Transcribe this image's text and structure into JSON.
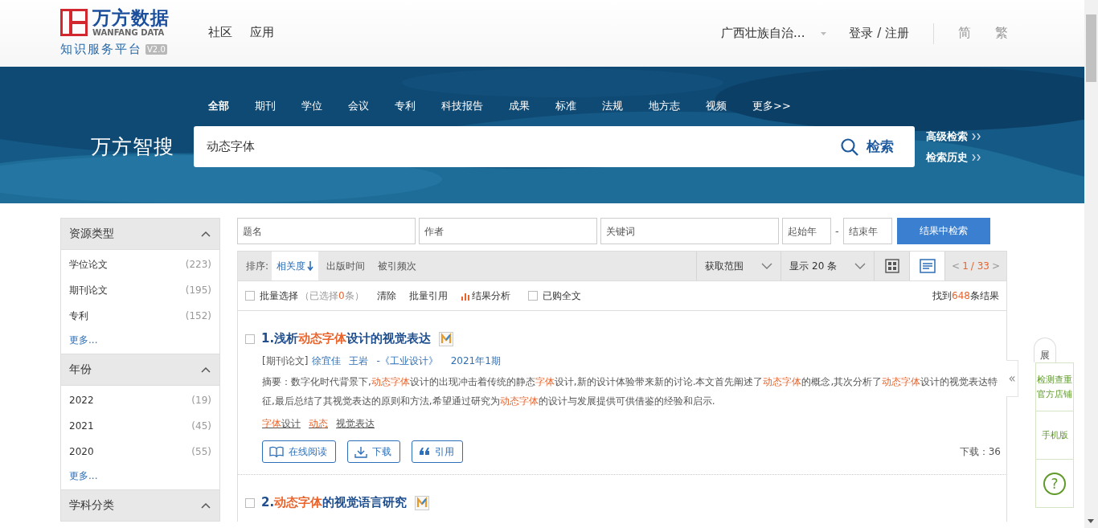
{
  "header": {
    "logo_name": "万方数据",
    "logo_sub": "WANFANG DATA",
    "platform": "知识服务平台",
    "version": "V2.0",
    "nav": [
      "社区",
      "应用"
    ],
    "region": "广西壮族自治...",
    "login": "登录 / 注册",
    "lang": [
      {
        "label": "简",
        "selected": false
      },
      {
        "label": "繁",
        "selected": false
      }
    ]
  },
  "search": {
    "tabs": [
      {
        "label": "全部",
        "selected": true
      },
      {
        "label": "期刊",
        "selected": false
      },
      {
        "label": "学位",
        "selected": false
      },
      {
        "label": "会议",
        "selected": false
      },
      {
        "label": "专利",
        "selected": false
      },
      {
        "label": "科技报告",
        "selected": false
      },
      {
        "label": "成果",
        "selected": false
      },
      {
        "label": "标准",
        "selected": false
      },
      {
        "label": "法规",
        "selected": false
      },
      {
        "label": "地方志",
        "selected": false
      },
      {
        "label": "视频",
        "selected": false
      },
      {
        "label": "更多>>",
        "selected": false
      }
    ],
    "brand": "万方智搜",
    "value": "动态字体",
    "button": "检索",
    "links": [
      "高级检索",
      "检索历史"
    ]
  },
  "facets": [
    {
      "title": "资源类型",
      "expanded": true,
      "items": [
        {
          "label": "学位论文",
          "count": "(223)"
        },
        {
          "label": "期刊论文",
          "count": "(195)"
        },
        {
          "label": "专利",
          "count": "(152)"
        }
      ],
      "more": "更多..."
    },
    {
      "title": "年份",
      "expanded": true,
      "items": [
        {
          "label": "2022",
          "count": "(19)"
        },
        {
          "label": "2021",
          "count": "(45)"
        },
        {
          "label": "2020",
          "count": "(55)"
        }
      ],
      "more": "更多..."
    },
    {
      "title": "学科分类",
      "expanded": true
    }
  ],
  "filters": {
    "fields": [
      {
        "placeholder": "题名"
      },
      {
        "placeholder": "作者"
      },
      {
        "placeholder": "关键词"
      },
      {
        "placeholder": "起始年"
      },
      {
        "placeholder": "结束年"
      }
    ],
    "dash": "-",
    "button": "结果中检索"
  },
  "sortbar": {
    "label": "排序:",
    "options": [
      {
        "label": "相关度",
        "selected": true
      },
      {
        "label": "出版时间",
        "selected": false
      },
      {
        "label": "被引频次",
        "selected": false
      }
    ],
    "range": "获取范围",
    "page_size": "显示 20 条",
    "views": [
      {
        "kind": "grid",
        "selected": false
      },
      {
        "kind": "list",
        "selected": true
      }
    ],
    "pager": {
      "prev": "<",
      "current": "1",
      "total": "/ 33",
      "next": ">"
    }
  },
  "actions": {
    "batch_select": {
      "label": "批量选择",
      "checked": false
    },
    "selected_pre": "（已选择",
    "selected_count": "0",
    "selected_post": "条）",
    "clear": "清除",
    "cite": "批量引用",
    "analysis": "结果分析",
    "purchased": {
      "label": "已购全文",
      "checked": false
    },
    "found_pre": "找到",
    "found_count": "648",
    "found_post": "条结果"
  },
  "results": [
    {
      "checked": false,
      "number": "1.",
      "title": [
        {
          "text": "浅析",
          "highlight": false
        },
        {
          "text": "动态字体",
          "highlight": true
        },
        {
          "text": "设计的视觉表达",
          "highlight": false
        }
      ],
      "type": "[期刊论文]",
      "authors": [
        "徐宜佳",
        "王岩"
      ],
      "source": "-《工业设计》",
      "issue": "2021年1期",
      "abstract": [
        {
          "text": "摘要：数字化时代背景下,",
          "highlight": false
        },
        {
          "text": "动态字体",
          "highlight": true
        },
        {
          "text": "设计的出现冲击着传统的静态",
          "highlight": false
        },
        {
          "text": "字体",
          "highlight": true
        },
        {
          "text": "设计,新的设计体验带来新的讨论.本文首先阐述了",
          "highlight": false
        },
        {
          "text": "动态字体",
          "highlight": true
        },
        {
          "text": "的概念,其次分析了",
          "highlight": false
        },
        {
          "text": "动态字体",
          "highlight": true
        },
        {
          "text": "设计的视觉表达特征,最后总结了其视觉表达的原则和方法,希望通过研究为",
          "highlight": false
        },
        {
          "text": "动态字体",
          "highlight": true
        },
        {
          "text": "的设计与发展提供可供借鉴的经验和启示.",
          "highlight": false
        }
      ],
      "keywords": [
        [
          {
            "text": "字体",
            "highlight": true
          },
          {
            "text": "设计",
            "highlight": false
          }
        ],
        [
          {
            "text": "动态",
            "highlight": true
          }
        ],
        [
          {
            "text": "视觉表达",
            "highlight": false
          }
        ]
      ],
      "buttons": [
        {
          "kind": "read",
          "label": "在线阅读"
        },
        {
          "kind": "download",
          "label": "下载"
        },
        {
          "kind": "cite",
          "label": "引用"
        }
      ],
      "downloads": "下载：36"
    },
    {
      "checked": false,
      "number": "2.",
      "title": [
        {
          "text": "动态字体",
          "highlight": true
        },
        {
          "text": "的视觉语言研究",
          "highlight": false
        }
      ]
    }
  ],
  "float_panel": {
    "tab": "展",
    "collapse": "«",
    "items": [
      {
        "kind": "text",
        "label": "检测查重官方店铺"
      },
      {
        "kind": "text",
        "label": "手机版"
      },
      {
        "kind": "help",
        "label": "?"
      }
    ]
  }
}
